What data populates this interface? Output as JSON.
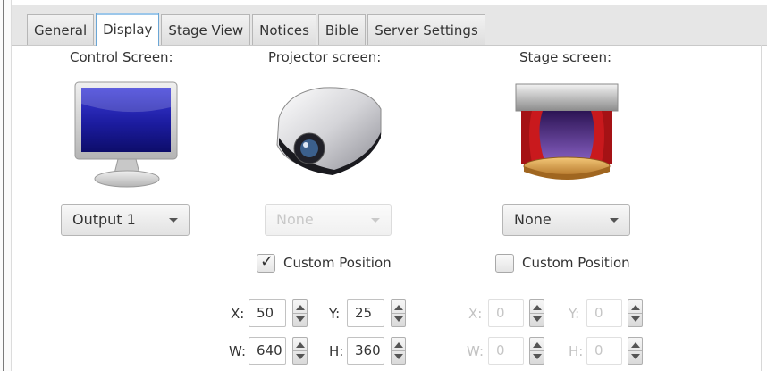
{
  "tabs": [
    "General",
    "Display",
    "Stage View",
    "Notices",
    "Bible",
    "Server Settings"
  ],
  "active_tab": "Display",
  "control": {
    "label": "Control Screen:",
    "icon": "monitor-icon",
    "output": "Output 1"
  },
  "projector": {
    "label": "Projector screen:",
    "icon": "projector-icon",
    "output": "None",
    "custom_position_label": "Custom Position",
    "custom_position_checked": true,
    "x_label": "X:",
    "x": "50",
    "y_label": "Y:",
    "y": "25",
    "w_label": "W:",
    "w": "640",
    "h_label": "H:",
    "h": "360"
  },
  "stage": {
    "label": "Stage screen:",
    "icon": "stage-theater-icon",
    "output": "None",
    "custom_position_label": "Custom Position",
    "custom_position_checked": false,
    "x_label": "X:",
    "x": "0",
    "y_label": "Y:",
    "y": "0",
    "w_label": "W:",
    "w": "0",
    "h_label": "H:",
    "h": "0"
  },
  "colors": {
    "tab_active_border": "#6aa6d6",
    "text": "#333333",
    "disabled_text": "#c2c2c2"
  }
}
